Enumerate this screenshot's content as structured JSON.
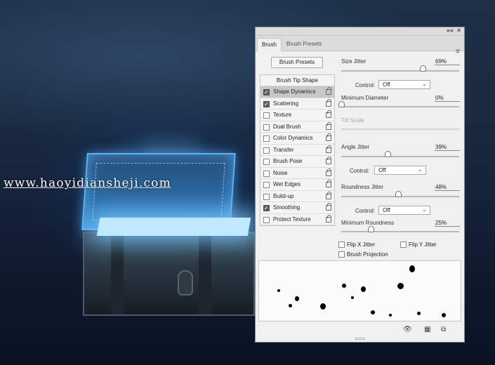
{
  "watermark": "www.haoyidiansheji.com",
  "panel": {
    "topbar": {
      "collapse_icon": "««",
      "close_icon": "×"
    },
    "tabs": [
      {
        "label": "Brush",
        "active": true
      },
      {
        "label": "Brush Presets",
        "active": false
      }
    ],
    "menu_icon": "≡",
    "presets_button": "Brush Presets",
    "options_header": "Brush Tip Shape",
    "options": [
      {
        "label": "Shape Dynamics",
        "checked": true,
        "selected": true
      },
      {
        "label": "Scattering",
        "checked": true,
        "selected": false
      },
      {
        "label": "Texture",
        "checked": false,
        "selected": false
      },
      {
        "label": "Dual Brush",
        "checked": false,
        "selected": false
      },
      {
        "label": "Color Dynamics",
        "checked": false,
        "selected": false
      },
      {
        "label": "Transfer",
        "checked": false,
        "selected": false
      },
      {
        "label": "Brush Pose",
        "checked": false,
        "selected": false
      },
      {
        "label": "Noise",
        "checked": false,
        "selected": false
      },
      {
        "label": "Wet Edges",
        "checked": false,
        "selected": false
      },
      {
        "label": "Build-up",
        "checked": false,
        "selected": false
      },
      {
        "label": "Smoothing",
        "checked": true,
        "selected": false
      },
      {
        "label": "Protect Texture",
        "checked": false,
        "selected": false
      }
    ],
    "size_jitter": {
      "label": "Size Jitter",
      "value": "69%",
      "level": 0.69
    },
    "control_1": {
      "label": "Control:",
      "value": "Off"
    },
    "min_diameter": {
      "label": "Minimum Diameter",
      "value": "0%",
      "level": 0.0
    },
    "tilt_scale": {
      "label": "Tilt Scale"
    },
    "angle_jitter": {
      "label": "Angle Jitter",
      "value": "39%",
      "level": 0.39
    },
    "control_2": {
      "label": "Control:",
      "value": "Off"
    },
    "roundness_jitter": {
      "label": "Roundness Jitter",
      "value": "48%",
      "level": 0.48
    },
    "control_3": {
      "label": "Control:",
      "value": "Off"
    },
    "min_roundness": {
      "label": "Minimum Roundness",
      "value": "25%",
      "level": 0.25
    },
    "flip_x": {
      "label": "Flip X Jitter",
      "checked": false
    },
    "flip_y": {
      "label": "Flip Y Jitter",
      "checked": false
    },
    "brush_projection": {
      "label": "Brush Projection",
      "checked": false
    },
    "bottom_icons": [
      "eye-brush-icon",
      "grid-icon",
      "new-preset-icon"
    ]
  }
}
